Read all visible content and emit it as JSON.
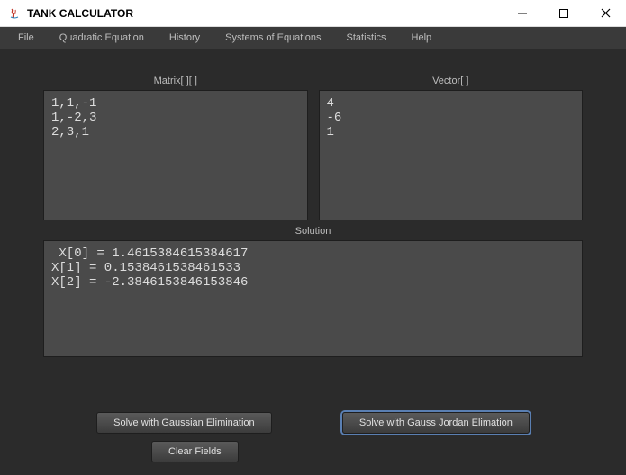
{
  "window": {
    "title": "TANK CALCULATOR"
  },
  "menu": {
    "file": "File",
    "quadratic": "Quadratic Equation",
    "history": "History",
    "systems": "Systems of Equations",
    "statistics": "Statistics",
    "help": "Help"
  },
  "labels": {
    "matrix": "Matrix[ ][ ]",
    "vector": "Vector[ ]",
    "solution": "Solution"
  },
  "inputs": {
    "matrix": "1,1,-1\n1,-2,3\n2,3,1",
    "vector": "4\n-6\n1",
    "solution": " X[0] = 1.4615384615384617\nX[1] = 0.1538461538461533\nX[2] = -2.3846153846153846"
  },
  "buttons": {
    "gaussian": "Solve with Gaussian Elimination",
    "gauss_jordan": "Solve with Gauss Jordan Elimation",
    "clear": "Clear Fields"
  }
}
